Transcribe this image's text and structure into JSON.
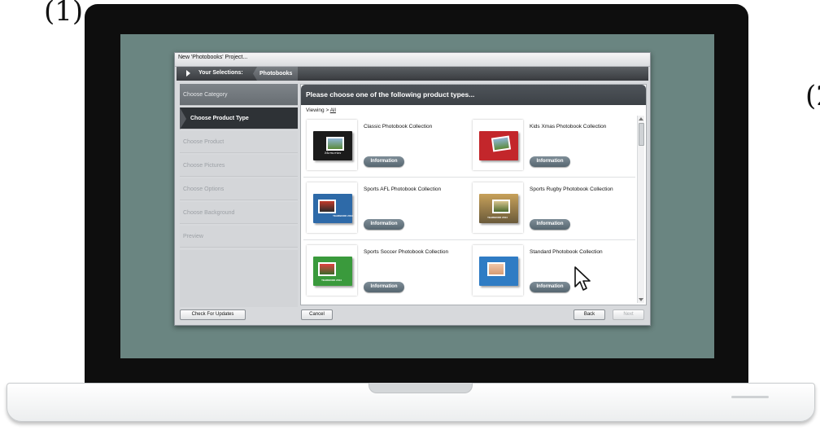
{
  "markers": {
    "left": "(1)",
    "right": "(2"
  },
  "window": {
    "title": "New 'Photobooks' Project..."
  },
  "selection": {
    "label": "Your Selections:",
    "value": "Photobooks"
  },
  "wizard_steps": [
    {
      "label": "Choose Category",
      "state": "done"
    },
    {
      "label": "Choose Product Type",
      "state": "active"
    },
    {
      "label": "Choose Product",
      "state": "pending"
    },
    {
      "label": "Choose Pictures",
      "state": "pending"
    },
    {
      "label": "Choose Options",
      "state": "pending"
    },
    {
      "label": "Choose Background",
      "state": "pending"
    },
    {
      "label": "Preview",
      "state": "pending"
    }
  ],
  "main": {
    "title": "Please choose one of the following product types...",
    "breadcrumb": {
      "prefix": "Viewing > ",
      "link": "All"
    },
    "info_label": "Information",
    "products": [
      {
        "name": "Classic Photobook Collection",
        "cover_color": "#1b1b1b",
        "cover_text": "Memories"
      },
      {
        "name": "Kids Xmas Photobook Collection",
        "cover_color": "#c3262b",
        "cover_text": ""
      },
      {
        "name": "Sports AFL Photobook Collection",
        "cover_color": "#2e6aa8",
        "cover_text": "YEARBOOK 2014"
      },
      {
        "name": "Sports Rugby Photobook Collection",
        "cover_color": "#c7a15a",
        "cover_text": "YEARBOOK 2014"
      },
      {
        "name": "Sports Soccer Photobook Collection",
        "cover_color": "#3a9a3c",
        "cover_text": "YEARBOOK 2014"
      },
      {
        "name": "Standard Photobook Collection",
        "cover_color": "#2f7cc4",
        "cover_text": ""
      }
    ]
  },
  "footer": {
    "check_updates": "Check For Updates",
    "cancel": "Cancel",
    "back": "Back",
    "next": "Next"
  }
}
